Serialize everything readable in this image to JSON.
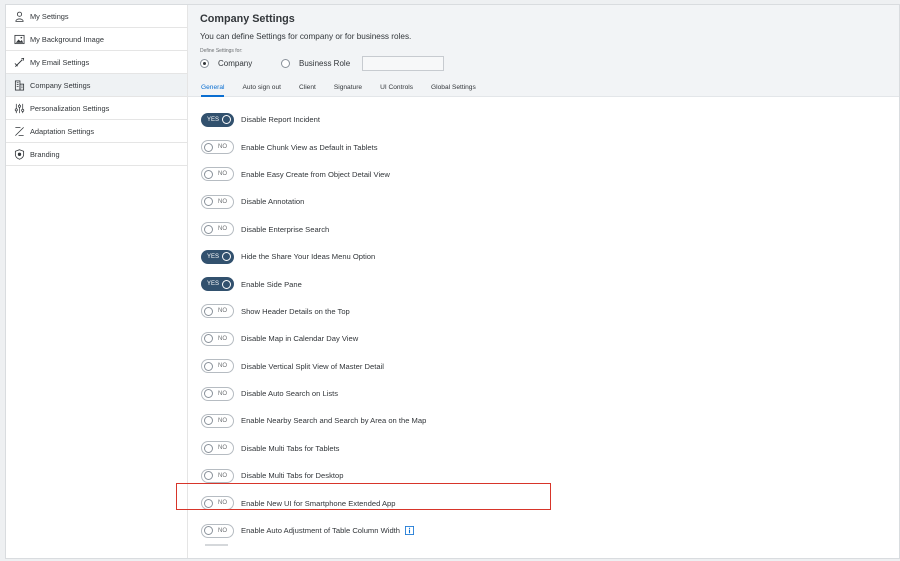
{
  "sidebar": {
    "items": [
      {
        "label": "My Settings",
        "icon": "person-icon",
        "active": false
      },
      {
        "label": "My Background Image",
        "icon": "image-icon",
        "active": false
      },
      {
        "label": "My Email Settings",
        "icon": "email-settings-icon",
        "active": false
      },
      {
        "label": "Company Settings",
        "icon": "building-icon",
        "active": true
      },
      {
        "label": "Personalization Settings",
        "icon": "sliders-icon",
        "active": false
      },
      {
        "label": "Adaptation Settings",
        "icon": "adaptation-icon",
        "active": false
      },
      {
        "label": "Branding",
        "icon": "badge-icon",
        "active": false
      }
    ]
  },
  "header": {
    "title": "Company Settings",
    "description": "You can define Settings for company or for business roles.",
    "define_label": "Define Settings for:",
    "radio_company": "Company",
    "radio_business": "Business Role",
    "selected_radio": "Company",
    "business_role_value": ""
  },
  "tabs": [
    {
      "label": "General",
      "active": true
    },
    {
      "label": "Auto sign out",
      "active": false
    },
    {
      "label": "Client",
      "active": false
    },
    {
      "label": "Signature",
      "active": false
    },
    {
      "label": "UI Controls",
      "active": false
    },
    {
      "label": "Global Settings",
      "active": false
    }
  ],
  "toggle_labels": {
    "on": "YES",
    "off": "NO"
  },
  "settings": [
    {
      "label": "Disable Report Incident",
      "value": true
    },
    {
      "label": "Enable Chunk View as Default in Tablets",
      "value": false
    },
    {
      "label": "Enable Easy Create from Object Detail View",
      "value": false
    },
    {
      "label": "Disable Annotation",
      "value": false
    },
    {
      "label": "Disable Enterprise Search",
      "value": false
    },
    {
      "label": "Hide the Share Your Ideas Menu Option",
      "value": true
    },
    {
      "label": "Enable Side Pane",
      "value": true
    },
    {
      "label": "Show Header Details on the Top",
      "value": false
    },
    {
      "label": "Disable Map in Calendar Day View",
      "value": false
    },
    {
      "label": "Disable Vertical Split View of Master Detail",
      "value": false
    },
    {
      "label": "Disable Auto Search on Lists",
      "value": false
    },
    {
      "label": "Enable Nearby Search and Search by Area on the Map",
      "value": false
    },
    {
      "label": "Disable Multi Tabs for Tablets",
      "value": false
    },
    {
      "label": "Disable Multi Tabs for Desktop",
      "value": false
    },
    {
      "label": "Enable New UI for Smartphone Extended App",
      "value": false,
      "highlighted": true
    },
    {
      "label": "Enable Auto Adjustment of Table Column Width",
      "value": false,
      "info_icon": true
    }
  ],
  "colors": {
    "toggle_on": "#32516e",
    "accent": "#0a6ed1",
    "highlight_border": "#d7352a",
    "info_icon": "#0a6ed1"
  }
}
